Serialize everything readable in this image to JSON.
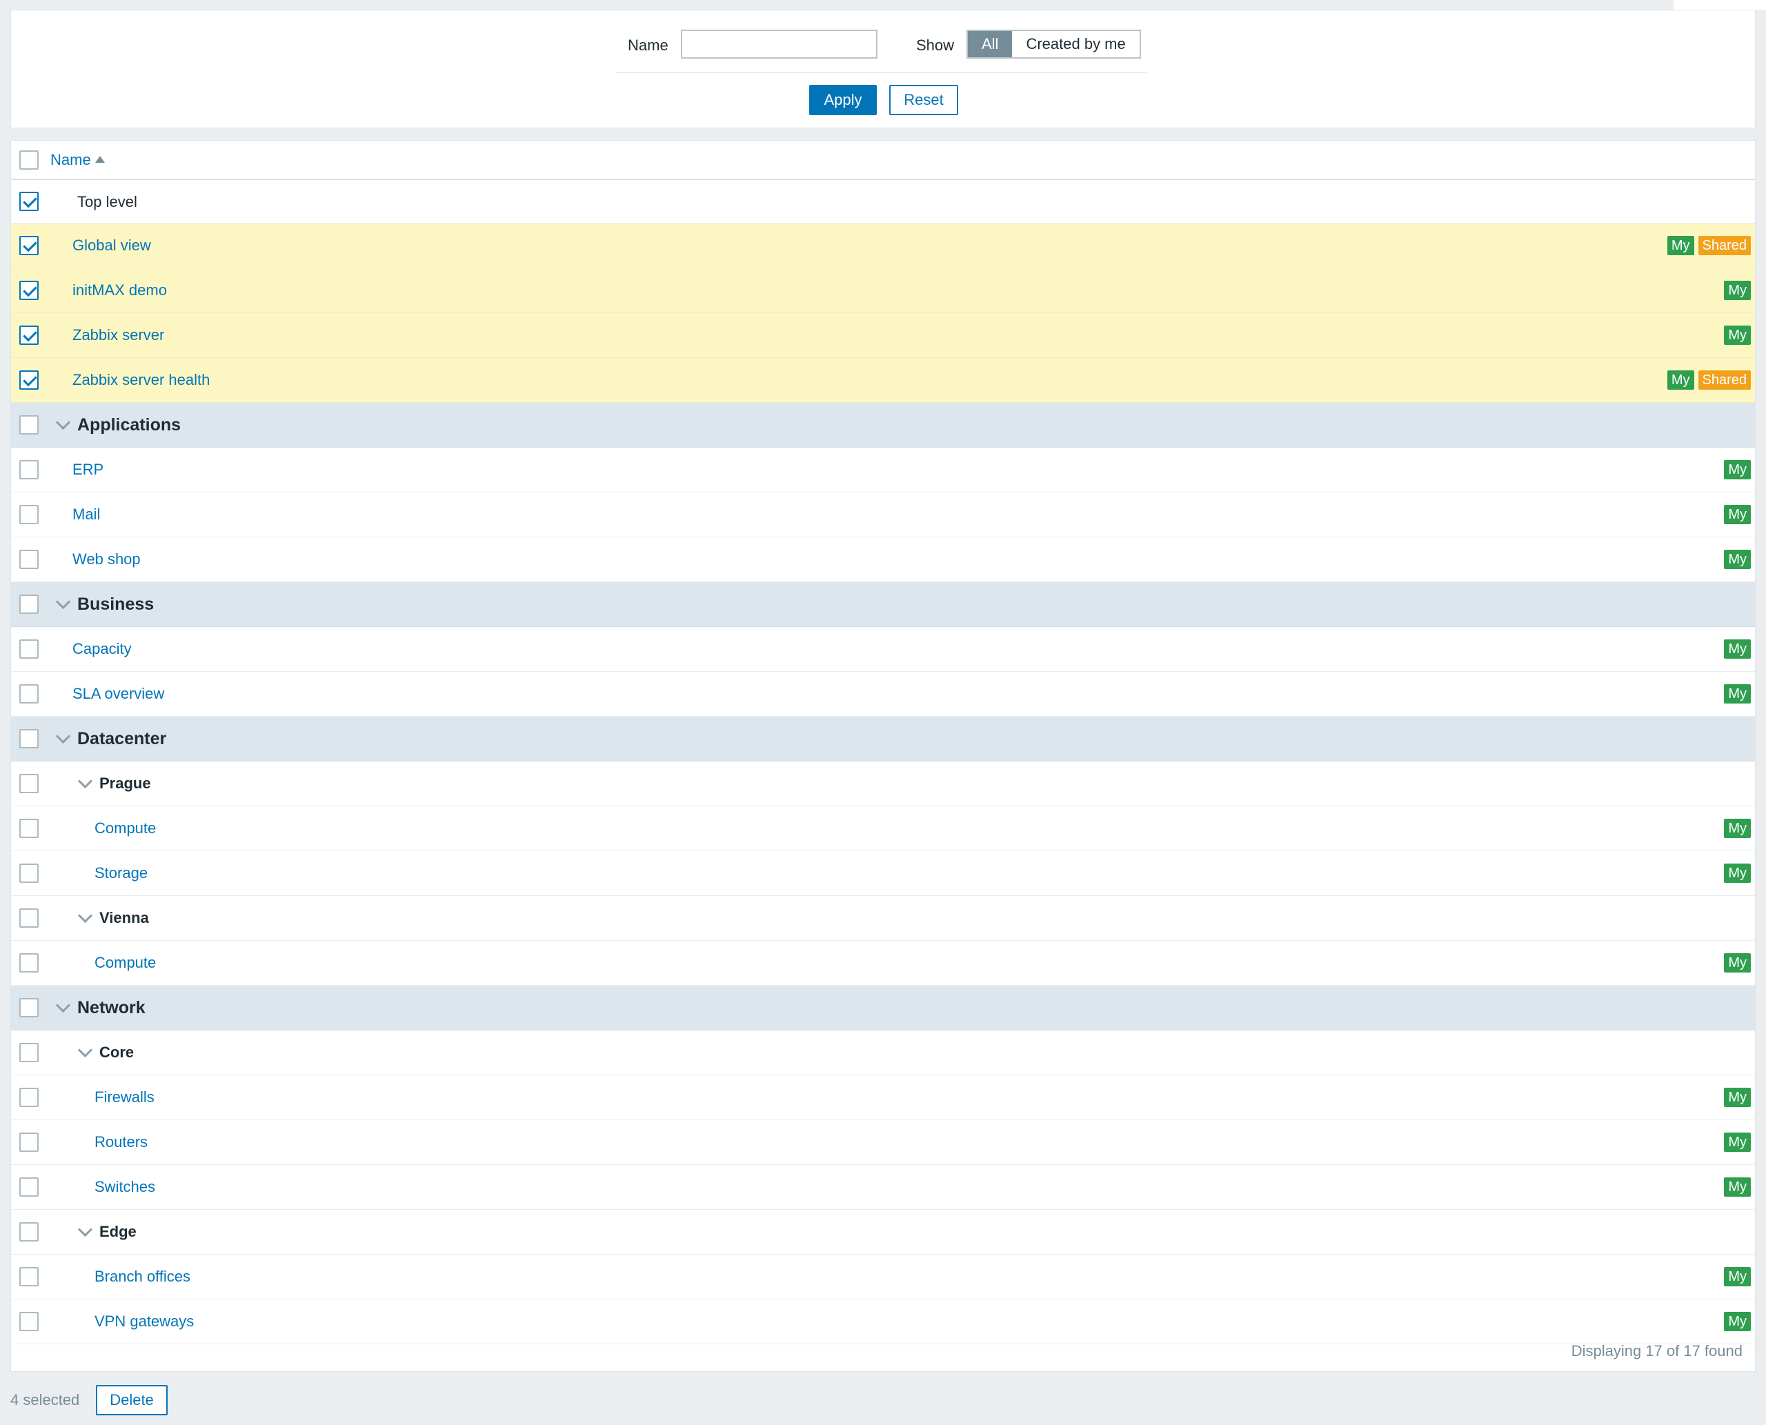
{
  "filter": {
    "name_label": "Name",
    "name_value": "",
    "show_label": "Show",
    "show_options": [
      "All",
      "Created by me"
    ],
    "show_selected": "All",
    "apply_label": "Apply",
    "reset_label": "Reset"
  },
  "table": {
    "column_name": "Name",
    "sort": "ascending",
    "rows": [
      {
        "kind": "group",
        "level": 0,
        "label": "Top level",
        "checked": true,
        "collapsible": false,
        "tags": []
      },
      {
        "kind": "item",
        "level": 1,
        "label": "Global view",
        "checked": true,
        "tags": [
          "My",
          "Shared"
        ]
      },
      {
        "kind": "item",
        "level": 1,
        "label": "initMAX demo",
        "checked": true,
        "tags": [
          "My"
        ]
      },
      {
        "kind": "item",
        "level": 1,
        "label": "Zabbix server",
        "checked": true,
        "tags": [
          "My"
        ]
      },
      {
        "kind": "item",
        "level": 1,
        "label": "Zabbix server health",
        "checked": true,
        "tags": [
          "My",
          "Shared"
        ]
      },
      {
        "kind": "group",
        "level": 0,
        "label": "Applications",
        "checked": false,
        "collapsible": true,
        "tags": []
      },
      {
        "kind": "item",
        "level": 1,
        "label": "ERP",
        "checked": false,
        "tags": [
          "My"
        ]
      },
      {
        "kind": "item",
        "level": 1,
        "label": "Mail",
        "checked": false,
        "tags": [
          "My"
        ]
      },
      {
        "kind": "item",
        "level": 1,
        "label": "Web shop",
        "checked": false,
        "tags": [
          "My"
        ]
      },
      {
        "kind": "group",
        "level": 0,
        "label": "Business",
        "checked": false,
        "collapsible": true,
        "tags": []
      },
      {
        "kind": "item",
        "level": 1,
        "label": "Capacity",
        "checked": false,
        "tags": [
          "My"
        ]
      },
      {
        "kind": "item",
        "level": 1,
        "label": "SLA overview",
        "checked": false,
        "tags": [
          "My"
        ]
      },
      {
        "kind": "group",
        "level": 0,
        "label": "Datacenter",
        "checked": false,
        "collapsible": true,
        "tags": []
      },
      {
        "kind": "subgroup",
        "level": 1,
        "label": "Prague",
        "checked": false,
        "collapsible": true,
        "tags": []
      },
      {
        "kind": "item",
        "level": 2,
        "label": "Compute",
        "checked": false,
        "tags": [
          "My"
        ]
      },
      {
        "kind": "item",
        "level": 2,
        "label": "Storage",
        "checked": false,
        "tags": [
          "My"
        ]
      },
      {
        "kind": "subgroup",
        "level": 1,
        "label": "Vienna",
        "checked": false,
        "collapsible": true,
        "tags": []
      },
      {
        "kind": "item",
        "level": 2,
        "label": "Compute",
        "checked": false,
        "tags": [
          "My"
        ]
      },
      {
        "kind": "group",
        "level": 0,
        "label": "Network",
        "checked": false,
        "collapsible": true,
        "tags": []
      },
      {
        "kind": "subgroup",
        "level": 1,
        "label": "Core",
        "checked": false,
        "collapsible": true,
        "tags": []
      },
      {
        "kind": "item",
        "level": 2,
        "label": "Firewalls",
        "checked": false,
        "tags": [
          "My"
        ]
      },
      {
        "kind": "item",
        "level": 2,
        "label": "Routers",
        "checked": false,
        "tags": [
          "My"
        ]
      },
      {
        "kind": "item",
        "level": 2,
        "label": "Switches",
        "checked": false,
        "tags": [
          "My"
        ]
      },
      {
        "kind": "subgroup",
        "level": 1,
        "label": "Edge",
        "checked": false,
        "collapsible": true,
        "tags": []
      },
      {
        "kind": "item",
        "level": 2,
        "label": "Branch offices",
        "checked": false,
        "tags": [
          "My"
        ]
      },
      {
        "kind": "item",
        "level": 2,
        "label": "VPN gateways",
        "checked": false,
        "tags": [
          "My"
        ]
      }
    ],
    "footer_text": "Displaying 17 of 17 found"
  },
  "bottom": {
    "selected_text": "4 selected",
    "delete_label": "Delete"
  },
  "colors": {
    "accent": "#0275b8",
    "tag_my": "#2f9e4f",
    "tag_shared": "#f2a11d",
    "selected_row": "#fcf7c2",
    "group_row": "#dee6ed"
  }
}
